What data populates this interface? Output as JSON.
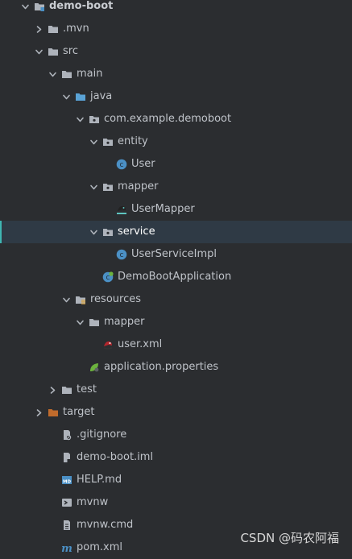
{
  "colors": {
    "background": "#2b2d30",
    "selected_row": "#2f3a45",
    "selected_border": "#3fb6b2",
    "text": "#bfc3c9",
    "folder": "#aeb3bb",
    "source_folder": "#5aa3d6",
    "class_icon": "#4b90c5",
    "target_folder": "#c06b2c"
  },
  "tree": [
    {
      "label": "demo-boot",
      "chevron": "down",
      "icon": "module-folder-icon",
      "depth": 0,
      "bold": true
    },
    {
      "label": ".mvn",
      "chevron": "right",
      "icon": "folder-icon",
      "depth": 1
    },
    {
      "label": "src",
      "chevron": "down",
      "icon": "folder-icon",
      "depth": 1
    },
    {
      "label": "main",
      "chevron": "down",
      "icon": "folder-icon",
      "depth": 2
    },
    {
      "label": "java",
      "chevron": "down",
      "icon": "source-folder-icon",
      "depth": 3
    },
    {
      "label": "com.example.demoboot",
      "chevron": "down",
      "icon": "package-icon",
      "depth": 4
    },
    {
      "label": "entity",
      "chevron": "down",
      "icon": "package-icon",
      "depth": 5
    },
    {
      "label": "User",
      "chevron": "none",
      "icon": "class-icon",
      "depth": 6
    },
    {
      "label": "mapper",
      "chevron": "down",
      "icon": "package-icon",
      "depth": 5
    },
    {
      "label": "UserMapper",
      "chevron": "none",
      "icon": "mybatis-mapper-icon",
      "depth": 6
    },
    {
      "label": "service",
      "chevron": "down",
      "icon": "package-icon",
      "depth": 5,
      "selected": true
    },
    {
      "label": "UserServiceImpl",
      "chevron": "none",
      "icon": "class-icon",
      "depth": 6
    },
    {
      "label": "DemoBootApplication",
      "chevron": "none",
      "icon": "spring-boot-class-icon",
      "depth": 5
    },
    {
      "label": "resources",
      "chevron": "down",
      "icon": "resources-folder-icon",
      "depth": 3
    },
    {
      "label": "mapper",
      "chevron": "down",
      "icon": "folder-icon",
      "depth": 4
    },
    {
      "label": "user.xml",
      "chevron": "none",
      "icon": "mybatis-xml-icon",
      "depth": 5
    },
    {
      "label": "application.properties",
      "chevron": "none",
      "icon": "spring-properties-icon",
      "depth": 4
    },
    {
      "label": "test",
      "chevron": "right",
      "icon": "folder-icon",
      "depth": 2
    },
    {
      "label": "target",
      "chevron": "right",
      "icon": "target-folder-icon",
      "depth": 1
    },
    {
      "label": ".gitignore",
      "chevron": "none",
      "icon": "gitignore-file-icon",
      "depth": 2
    },
    {
      "label": "demo-boot.iml",
      "chevron": "none",
      "icon": "iml-file-icon",
      "depth": 2
    },
    {
      "label": "HELP.md",
      "chevron": "none",
      "icon": "markdown-file-icon",
      "depth": 2
    },
    {
      "label": "mvnw",
      "chevron": "none",
      "icon": "shell-file-icon",
      "depth": 2
    },
    {
      "label": "mvnw.cmd",
      "chevron": "none",
      "icon": "text-file-icon",
      "depth": 2
    },
    {
      "label": "pom.xml",
      "chevron": "none",
      "icon": "maven-pom-icon",
      "depth": 2
    }
  ],
  "watermark": "CSDN @码农阿福"
}
